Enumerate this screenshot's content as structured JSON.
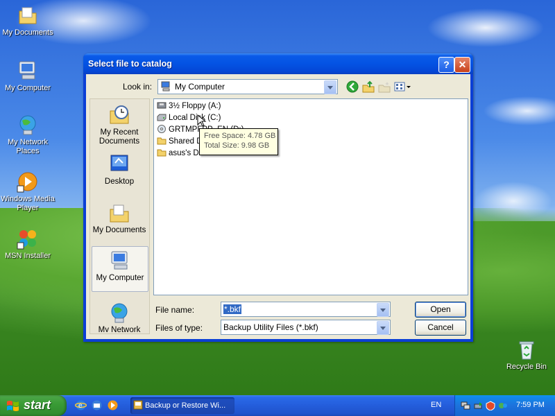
{
  "desktop": {
    "icons": [
      {
        "label": "My Documents",
        "icon": "my-documents-icon"
      },
      {
        "label": "My Computer",
        "icon": "my-computer-icon"
      },
      {
        "label": "My Network Places",
        "icon": "network-places-icon"
      },
      {
        "label": "Windows Media Player",
        "icon": "media-player-icon"
      },
      {
        "label": "MSN Installer",
        "icon": "msn-icon"
      },
      {
        "label": "Recycle Bin",
        "icon": "recycle-bin-icon"
      }
    ]
  },
  "dialog": {
    "title": "Select file to catalog",
    "look_in_label": "Look in:",
    "look_in_value": "My Computer",
    "places": [
      {
        "label": "My Recent Documents"
      },
      {
        "label": "Desktop"
      },
      {
        "label": "My Documents"
      },
      {
        "label": "My Computer",
        "selected": true
      },
      {
        "label": "My Network"
      }
    ],
    "files": [
      {
        "name": "3½ Floppy (A:)",
        "icon": "floppy-icon"
      },
      {
        "name": "Local Disk (C:)",
        "icon": "hard-disk-icon"
      },
      {
        "name": "GRTMPFPP_EN (D:)",
        "icon": "cd-drive-icon"
      },
      {
        "name": "Shared Documents",
        "icon": "folder-icon"
      },
      {
        "name": "asus's Documents",
        "icon": "folder-icon"
      }
    ],
    "tooltip": {
      "free_space": "Free Space: 4.78 GB",
      "total_size": "Total Size: 9.98 GB"
    },
    "file_name_label": "File name:",
    "file_name_value": "*.bkf",
    "files_of_type_label": "Files of type:",
    "files_of_type_value": "Backup Utility Files (*.bkf)",
    "open_button": "Open",
    "cancel_button": "Cancel",
    "help_button": "?",
    "close_button": "✕"
  },
  "taskbar": {
    "start_label": "start",
    "task_label": "Backup or Restore Wi...",
    "language": "EN",
    "clock": "7:59 PM"
  }
}
